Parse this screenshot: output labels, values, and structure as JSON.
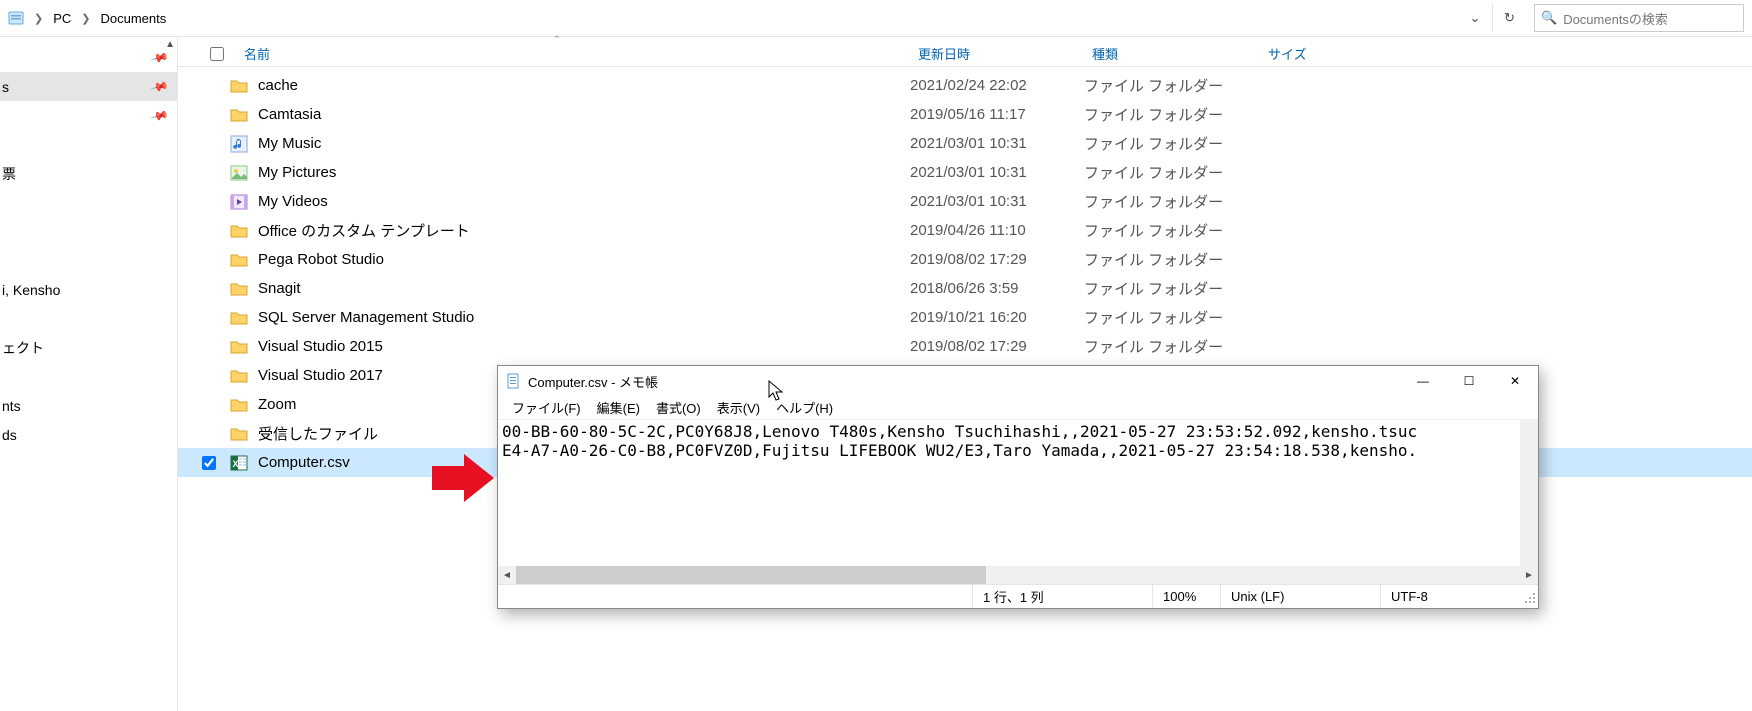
{
  "breadcrumb": {
    "items": [
      "PC",
      "Documents"
    ]
  },
  "search": {
    "placeholder": "Documentsの検索"
  },
  "sidebar": {
    "items": [
      {
        "label": "",
        "pinned": true
      },
      {
        "label": "s",
        "pinned": true,
        "selected": true
      },
      {
        "label": "",
        "pinned": true
      },
      {
        "label": "",
        "pinned": false
      },
      {
        "label": "票",
        "pinned": false
      },
      {
        "label": "",
        "pinned": false
      },
      {
        "label": "",
        "pinned": false
      },
      {
        "label": "",
        "pinned": false
      },
      {
        "label": "i, Kensho",
        "pinned": false
      },
      {
        "label": "",
        "pinned": false
      },
      {
        "label": "ェクト",
        "pinned": false
      },
      {
        "label": "",
        "pinned": false
      },
      {
        "label": "nts",
        "pinned": false
      },
      {
        "label": "ds",
        "pinned": false
      }
    ]
  },
  "columns": {
    "name": "名前",
    "date": "更新日時",
    "type": "種類",
    "size": "サイズ"
  },
  "rows": [
    {
      "icon": "folder",
      "name": "cache",
      "date": "2021/02/24 22:02",
      "type": "ファイル フォルダー"
    },
    {
      "icon": "folder",
      "name": "Camtasia",
      "date": "2019/05/16 11:17",
      "type": "ファイル フォルダー"
    },
    {
      "icon": "music",
      "name": "My Music",
      "date": "2021/03/01 10:31",
      "type": "ファイル フォルダー"
    },
    {
      "icon": "pictures",
      "name": "My Pictures",
      "date": "2021/03/01 10:31",
      "type": "ファイル フォルダー"
    },
    {
      "icon": "videos",
      "name": "My Videos",
      "date": "2021/03/01 10:31",
      "type": "ファイル フォルダー"
    },
    {
      "icon": "folder",
      "name": "Office のカスタム テンプレート",
      "date": "2019/04/26 11:10",
      "type": "ファイル フォルダー"
    },
    {
      "icon": "folder",
      "name": "Pega Robot Studio",
      "date": "2019/08/02 17:29",
      "type": "ファイル フォルダー"
    },
    {
      "icon": "folder",
      "name": "Snagit",
      "date": "2018/06/26 3:59",
      "type": "ファイル フォルダー"
    },
    {
      "icon": "folder",
      "name": "SQL Server Management Studio",
      "date": "2019/10/21 16:20",
      "type": "ファイル フォルダー"
    },
    {
      "icon": "folder",
      "name": "Visual Studio 2015",
      "date": "2019/08/02 17:29",
      "type": "ファイル フォルダー"
    },
    {
      "icon": "folder",
      "name": "Visual Studio 2017",
      "date": "",
      "type": ""
    },
    {
      "icon": "folder",
      "name": "Zoom",
      "date": "",
      "type": ""
    },
    {
      "icon": "folder",
      "name": "受信したファイル",
      "date": "",
      "type": ""
    },
    {
      "icon": "excel",
      "name": "Computer.csv",
      "date": "",
      "type": "",
      "selected": true,
      "checked": true
    }
  ],
  "notepad": {
    "title": "Computer.csv - メモ帳",
    "menu": [
      "ファイル(F)",
      "編集(E)",
      "書式(O)",
      "表示(V)",
      "ヘルプ(H)"
    ],
    "text_lines": [
      "00-BB-60-80-5C-2C,PC0Y68J8,Lenovo T480s,Kensho Tsuchihashi,,2021-05-27 23:53:52.092,kensho.tsuc",
      "E4-A7-A0-26-C0-B8,PC0FVZ0D,Fujitsu LIFEBOOK WU2/E3,Taro Yamada,,2021-05-27 23:54:18.538,kensho."
    ],
    "status": {
      "cursor": "1 行、1 列",
      "zoom": "100%",
      "eol": "Unix (LF)",
      "encoding": "UTF-8"
    }
  }
}
